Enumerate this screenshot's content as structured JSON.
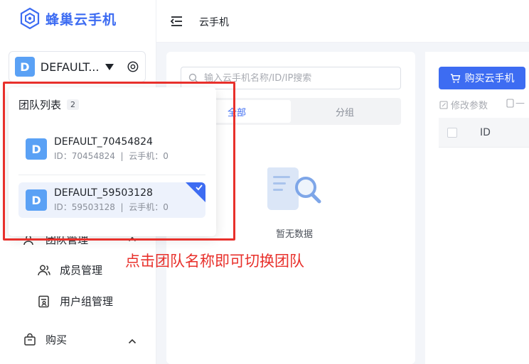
{
  "brand": {
    "name": "蜂巢云手机",
    "logo_icon": "hexagon-logo-icon"
  },
  "team_switcher": {
    "avatar_letter": "D",
    "current_team": "DEFAULT...",
    "settings_icon": "settings-icon"
  },
  "sidebar": {
    "items": [
      {
        "label": "团队管理",
        "icon": "team-icon"
      },
      {
        "label": "成员管理",
        "icon": "member-icon"
      },
      {
        "label": "用户组管理",
        "icon": "user-group-icon"
      },
      {
        "label": "购买",
        "icon": "bag-icon"
      }
    ]
  },
  "header": {
    "breadcrumb": "云手机",
    "menu_icon": "collapse-menu-icon"
  },
  "left_panel": {
    "search_placeholder": "输入云手机名称/ID/IP搜索",
    "tabs": [
      {
        "label": "全部",
        "active": true
      },
      {
        "label": "分组",
        "active": false
      }
    ],
    "empty_text": "暂无数据"
  },
  "right_panel": {
    "buy_button": "购买云手机",
    "modify_link": "修改参数",
    "more_link": "—",
    "table_headers": [
      "ID"
    ]
  },
  "dropdown": {
    "title": "团队列表",
    "count": "2",
    "teams": [
      {
        "avatar_letter": "D",
        "name": "DEFAULT_70454824",
        "id_label": "ID：",
        "id": "70454824",
        "sep": "|",
        "phones_label": "云手机：",
        "phones": "0",
        "selected": false
      },
      {
        "avatar_letter": "D",
        "name": "DEFAULT_59503128",
        "id_label": "ID：",
        "id": "59503128",
        "sep": "|",
        "phones_label": "云手机：",
        "phones": "0",
        "selected": true
      }
    ]
  },
  "annotation": {
    "text": "点击团队名称即可切换团队",
    "color": "#e8302b"
  },
  "colors": {
    "primary": "#3d6cf2",
    "avatar": "#5aa1f5",
    "annotation": "#e8302b"
  }
}
